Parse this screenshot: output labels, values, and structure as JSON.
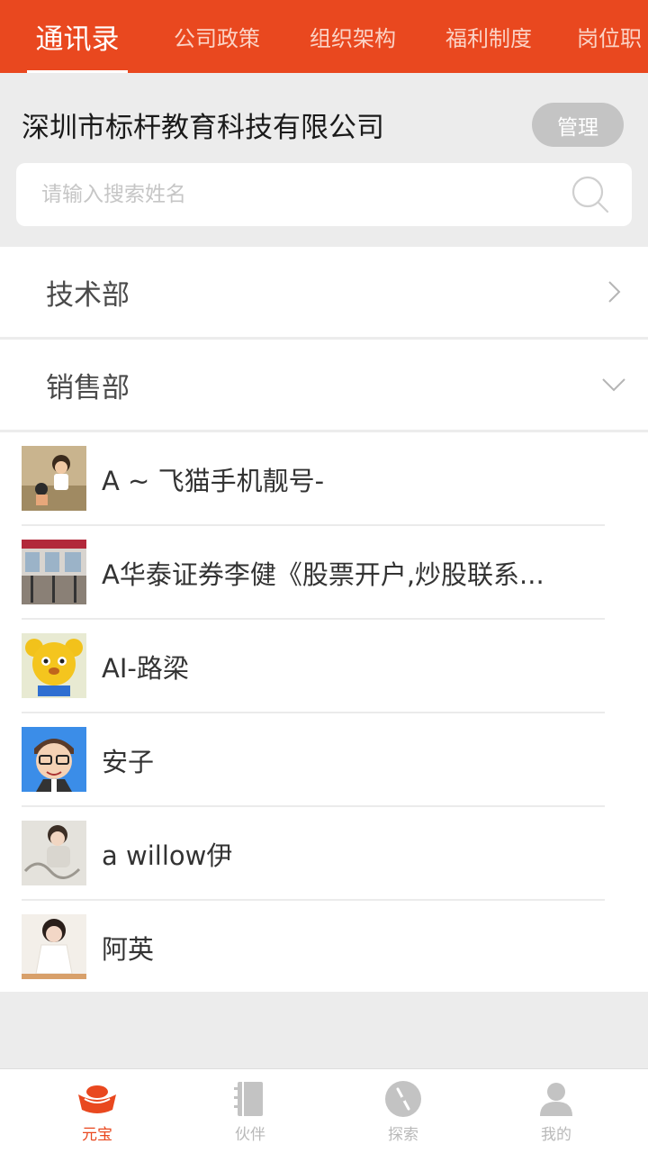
{
  "top_tabs": [
    {
      "label": "通讯录",
      "active": true
    },
    {
      "label": "公司政策",
      "active": false
    },
    {
      "label": "组织架构",
      "active": false
    },
    {
      "label": "福利制度",
      "active": false
    },
    {
      "label": "岗位职",
      "active": false
    }
  ],
  "company": {
    "name": "深圳市标杆教育科技有限公司",
    "manage_label": "管理"
  },
  "search": {
    "placeholder": "请输入搜索姓名",
    "value": ""
  },
  "departments": [
    {
      "name": "技术部",
      "expanded": false,
      "icon": "chevron-right-icon"
    },
    {
      "name": "销售部",
      "expanded": true,
      "icon": "chevron-down-icon"
    }
  ],
  "members": [
    {
      "name": "A ~ 飞猫手机靓号-",
      "avatar": "photo-avatar"
    },
    {
      "name": "A华泰证券李健《股票开户,炒股联系...",
      "avatar": "photo-avatar"
    },
    {
      "name": "AI-路梁",
      "avatar": "bear-avatar"
    },
    {
      "name": "安子",
      "avatar": "cartoon-avatar"
    },
    {
      "name": "a willow伊",
      "avatar": "photo-avatar"
    },
    {
      "name": "阿英",
      "avatar": "photo-avatar"
    }
  ],
  "bottom_nav": [
    {
      "label": "元宝",
      "icon": "ingot-icon",
      "active": true
    },
    {
      "label": "伙伴",
      "icon": "notebook-icon",
      "active": false
    },
    {
      "label": "探索",
      "icon": "compass-icon",
      "active": false
    },
    {
      "label": "我的",
      "icon": "user-icon",
      "active": false
    }
  ],
  "colors": {
    "accent": "#e9481f",
    "background": "#ececec",
    "inactive_nav": "#b9b9b9"
  }
}
